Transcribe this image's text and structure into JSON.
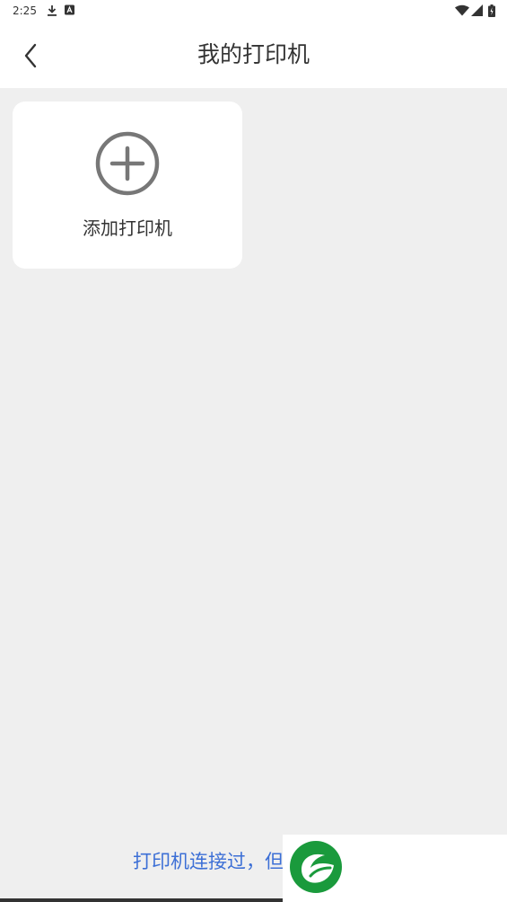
{
  "status_bar": {
    "time": "2:25",
    "icons": [
      "download-icon",
      "a-icon",
      "wifi-icon",
      "signal-icon",
      "battery-icon"
    ]
  },
  "header": {
    "title": "我的打印机",
    "back_icon": "chevron-left-icon"
  },
  "add_printer": {
    "label": "添加打印机",
    "icon": "plus-circle-icon"
  },
  "bottom": {
    "hint_text": "打印机连接过，但"
  },
  "colors": {
    "background": "#efefef",
    "surface": "#ffffff",
    "text": "#333333",
    "icon_gray": "#777777",
    "link_blue": "#3c6fd6",
    "logo_green": "#1a9a3c"
  }
}
